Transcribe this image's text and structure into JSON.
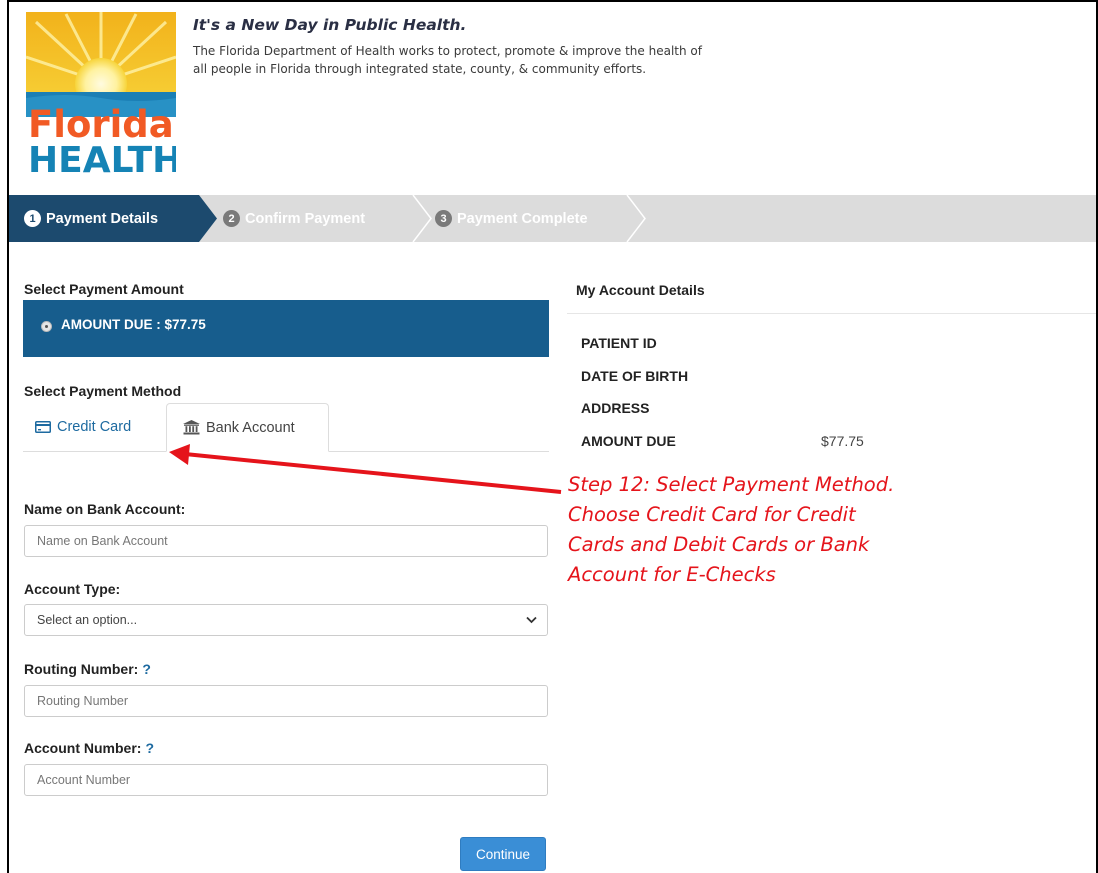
{
  "header": {
    "logo_text_top": "Florida",
    "logo_text_bottom": "HEALTH",
    "tagline": "It's a New Day in Public Health.",
    "mission": "The Florida Department of Health works to protect, promote & improve the health of all people in Florida through integrated state, county, & community efforts."
  },
  "steps": [
    {
      "num": "1",
      "label": "Payment Details",
      "active": true
    },
    {
      "num": "2",
      "label": "Confirm Payment",
      "active": false
    },
    {
      "num": "3",
      "label": "Payment Complete",
      "active": false
    }
  ],
  "payment": {
    "amount_title": "Select Payment Amount",
    "amount_due_label": "AMOUNT DUE : $77.75",
    "method_title": "Select Payment Method",
    "tabs": [
      {
        "label": "Credit Card",
        "icon": "credit-card-icon",
        "selected": false
      },
      {
        "label": "Bank Account",
        "icon": "bank-icon",
        "selected": true
      }
    ]
  },
  "form": {
    "name_label": "Name on Bank Account:",
    "name_placeholder": "Name on Bank Account",
    "account_type_label": "Account Type:",
    "account_type_value": "Select an option...",
    "routing_label": "Routing Number:",
    "routing_help": "?",
    "routing_placeholder": "Routing Number",
    "account_label": "Account Number:",
    "account_help": "?",
    "account_placeholder": "Account Number",
    "continue_label": "Continue"
  },
  "account": {
    "title": "My Account Details",
    "rows": [
      {
        "label": "PATIENT ID",
        "value": ""
      },
      {
        "label": "DATE OF BIRTH",
        "value": ""
      },
      {
        "label": "ADDRESS",
        "value": ""
      },
      {
        "label": "AMOUNT DUE",
        "value": "$77.75"
      }
    ]
  },
  "annotation": {
    "lines": [
      "Step 12: Select Payment Method.",
      "Choose Credit Card for Credit",
      "Cards and Debit Cards or Bank",
      "Account for E-Checks"
    ]
  },
  "colors": {
    "brand_blue": "#175d8d",
    "active_step": "#1c4a6e",
    "link_blue": "#1d6aa0",
    "annotation_red": "#e5141b",
    "button_blue": "#3a8ed6"
  }
}
